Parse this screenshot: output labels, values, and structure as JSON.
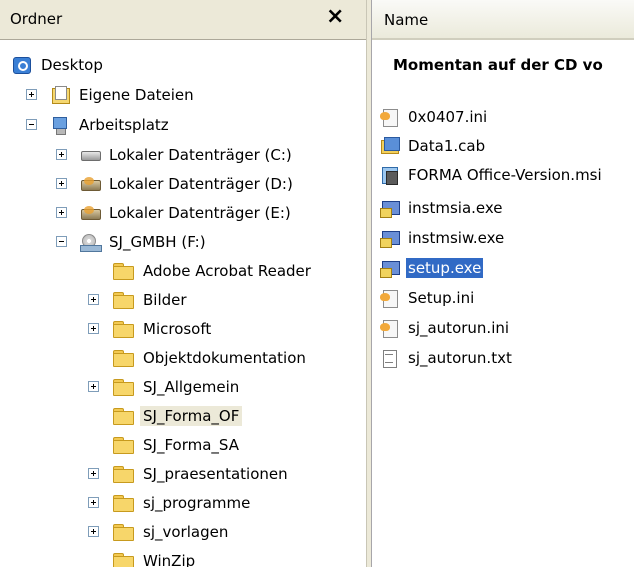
{
  "folder_pane": {
    "title": "Ordner",
    "close_glyph": "×",
    "tree": {
      "desktop": "Desktop",
      "eigene_dateien": "Eigene Dateien",
      "arbeitsplatz": "Arbeitsplatz",
      "drive_c": "Lokaler Datenträger (C:)",
      "drive_d": "Lokaler Datenträger (D:)",
      "drive_e": "Lokaler Datenträger (E:)",
      "drive_f": "SJ_GMBH (F:)",
      "folders": [
        "Adobe Acrobat Reader",
        "Bilder",
        "Microsoft",
        "Objektdokumentation",
        "SJ_Allgemein",
        "SJ_Forma_OF",
        "SJ_Forma_SA",
        "SJ_praesentationen",
        "sj_programme",
        "sj_vorlagen",
        "WinZip"
      ]
    }
  },
  "file_pane": {
    "column_name": "Name",
    "path_text": "Momentan auf der CD vo",
    "files": [
      {
        "name": "0x0407.ini",
        "icon": "ini-file-icon"
      },
      {
        "name": "Data1.cab",
        "icon": "cab-file-icon"
      },
      {
        "name": "FORMA Office-Version.msi",
        "icon": "msi-file-icon"
      },
      {
        "name": "instmsia.exe",
        "icon": "exe-file-icon"
      },
      {
        "name": "instmsiw.exe",
        "icon": "exe-file-icon"
      },
      {
        "name": "setup.exe",
        "icon": "setup-exe-icon"
      },
      {
        "name": "Setup.ini",
        "icon": "ini-file-icon"
      },
      {
        "name": "sj_autorun.ini",
        "icon": "ini-file-icon"
      },
      {
        "name": "sj_autorun.txt",
        "icon": "txt-file-icon"
      }
    ]
  },
  "selected_folder": "SJ_Forma_OF",
  "selected_file": "setup.exe",
  "colors": {
    "highlight": "#316ac5",
    "header": "#ece9d8"
  }
}
